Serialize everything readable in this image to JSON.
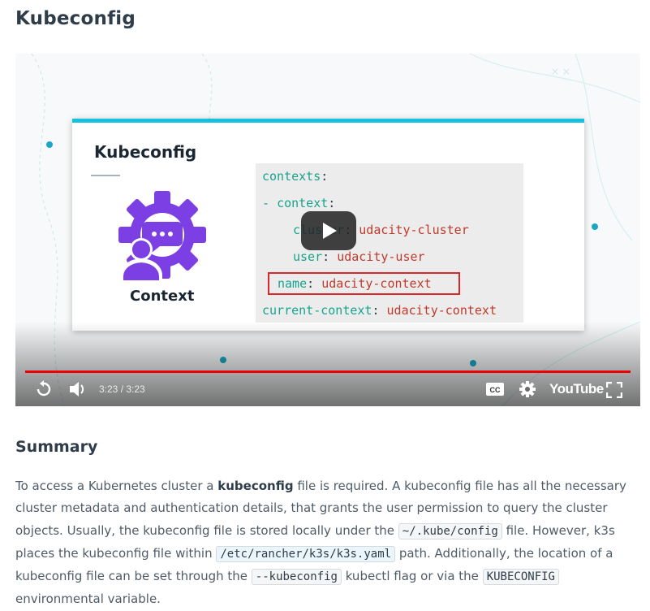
{
  "page": {
    "title": "Kubeconfig"
  },
  "video": {
    "slide": {
      "title": "Kubeconfig",
      "icon_label": "Context",
      "code": {
        "l1_key": "contexts",
        "l1_sep": ":",
        "l2_dash": "- ",
        "l2_key": "context",
        "l2_sep": ":",
        "l3_key": "cluster",
        "l3_sep": ": ",
        "l3_val": "udacity-cluster",
        "l4_key": "user",
        "l4_sep": ": ",
        "l4_val": "udacity-user",
        "l5_key": "name",
        "l5_sep": ": ",
        "l5_val": "udacity-context",
        "l6_key": "current-context",
        "l6_sep": ": ",
        "l6_val": "udacity-context"
      }
    },
    "controls": {
      "time": "3:23 / 3:23",
      "progress_fraction": 1.0,
      "youtube_label": "YouTube",
      "cc_label": "CC"
    }
  },
  "summary": {
    "heading": "Summary",
    "t1": "To access a Kubernetes cluster a ",
    "b1": "kubeconfig",
    "t2": " file is required. A kubeconfig file has all the necessary cluster metadata and authentication details, that grants the user permission to query the cluster objects. Usually, the kubeconfig file is stored locally under the ",
    "c1": "~/.kube/config",
    "t3": " file. However, k3s places the kubeconfig file within ",
    "c2": "/etc/rancher/k3s/k3s.yaml",
    "t4": " path. Additionally, the location of a kubeconfig file can be set through the ",
    "c3": "--kubeconfig",
    "t5": " kubectl flag or via the ",
    "c4": "KUBECONFIG",
    "t6": " environmental variable."
  },
  "colors": {
    "accent": "#15c2dd",
    "progress": "#ee0000",
    "icon": "#7b3fe4",
    "highlight": "#d9272e"
  }
}
